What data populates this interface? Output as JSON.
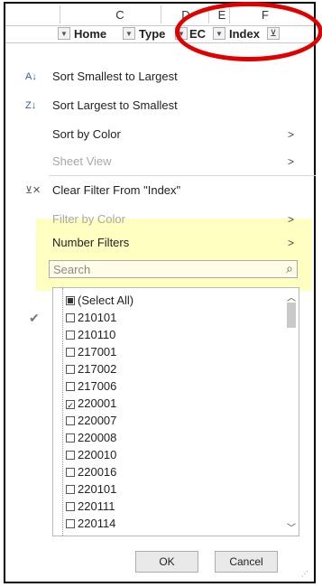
{
  "columns": {
    "letters": [
      "C",
      "D",
      "E",
      "F"
    ]
  },
  "header": {
    "home": "Home",
    "type": "Type",
    "ec": "EC",
    "index": "Index"
  },
  "menu": {
    "sort_asc": "Sort Smallest to Largest",
    "sort_desc": "Sort Largest to Smallest",
    "sort_by_color": "Sort by Color",
    "sheet_view": "Sheet View",
    "clear_filter": "Clear Filter From \"Index\"",
    "filter_by_color": "Filter by Color",
    "number_filters": "Number Filters"
  },
  "search": {
    "placeholder": "Search"
  },
  "list": {
    "items": [
      {
        "label": "(Select All)",
        "state": "partial"
      },
      {
        "label": "210101",
        "state": "unchecked"
      },
      {
        "label": "210110",
        "state": "unchecked"
      },
      {
        "label": "217001",
        "state": "unchecked"
      },
      {
        "label": "217002",
        "state": "unchecked"
      },
      {
        "label": "217006",
        "state": "unchecked"
      },
      {
        "label": "220001",
        "state": "checked"
      },
      {
        "label": "220007",
        "state": "unchecked"
      },
      {
        "label": "220008",
        "state": "unchecked"
      },
      {
        "label": "220010",
        "state": "unchecked"
      },
      {
        "label": "220016",
        "state": "unchecked"
      },
      {
        "label": "220101",
        "state": "unchecked"
      },
      {
        "label": "220111",
        "state": "unchecked"
      },
      {
        "label": "220114",
        "state": "unchecked"
      }
    ]
  },
  "buttons": {
    "ok": "OK",
    "cancel": "Cancel"
  },
  "colors": {
    "annotation": "#e00000",
    "highlight": "#ffff78"
  }
}
